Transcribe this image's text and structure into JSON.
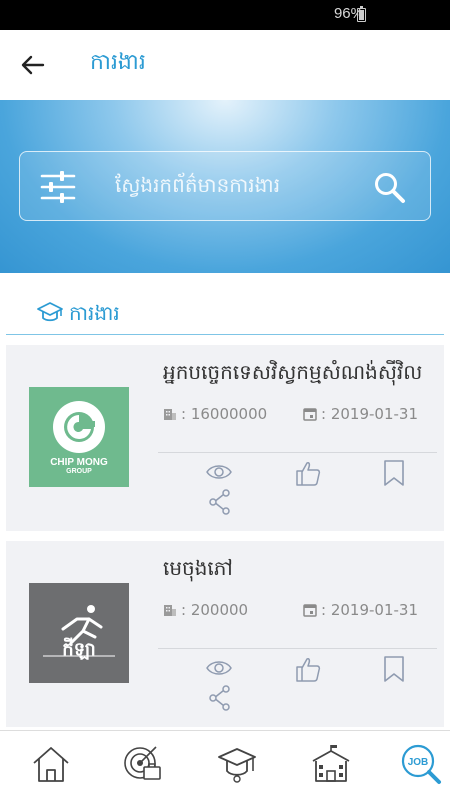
{
  "status_bar": {
    "battery": "96%"
  },
  "app_bar": {
    "title": "ការងារ"
  },
  "search": {
    "placeholder": "ស្វែងរកព័ត៌មានការងារ"
  },
  "section": {
    "title": "ការងារ"
  },
  "jobs": [
    {
      "title": "អ្នកបច្ចេកទេសវិស្វកម្មសំណង់ស៊ីវិល",
      "salary": ": 16000000",
      "deadline": ": 2019-01-31",
      "logo_text_line1": "CHIP MONG",
      "logo_text_line2": "GROUP"
    },
    {
      "title": "មេចុងភៅ",
      "salary": ": 200000",
      "deadline": ": 2019-01-31",
      "logo_text_line1": "កីឡា"
    }
  ],
  "icons": {
    "back": "back-arrow-icon",
    "filter": "sliders-icon",
    "search": "search-icon",
    "section": "graduation-cap-icon",
    "salary": "building-icon",
    "deadline": "calendar-icon",
    "view": "eye-icon",
    "share": "share-icon",
    "like": "thumbs-up-icon",
    "bookmark": "bookmark-icon"
  },
  "bottom_nav": [
    "home-icon",
    "career-target-icon",
    "graduation-cap-icon",
    "school-icon",
    "job-search-icon"
  ],
  "colors": {
    "accent": "#2c9bd3",
    "hero": "#3595d2",
    "card": "#f1f2f5",
    "chipmong": "#6fba8e"
  }
}
